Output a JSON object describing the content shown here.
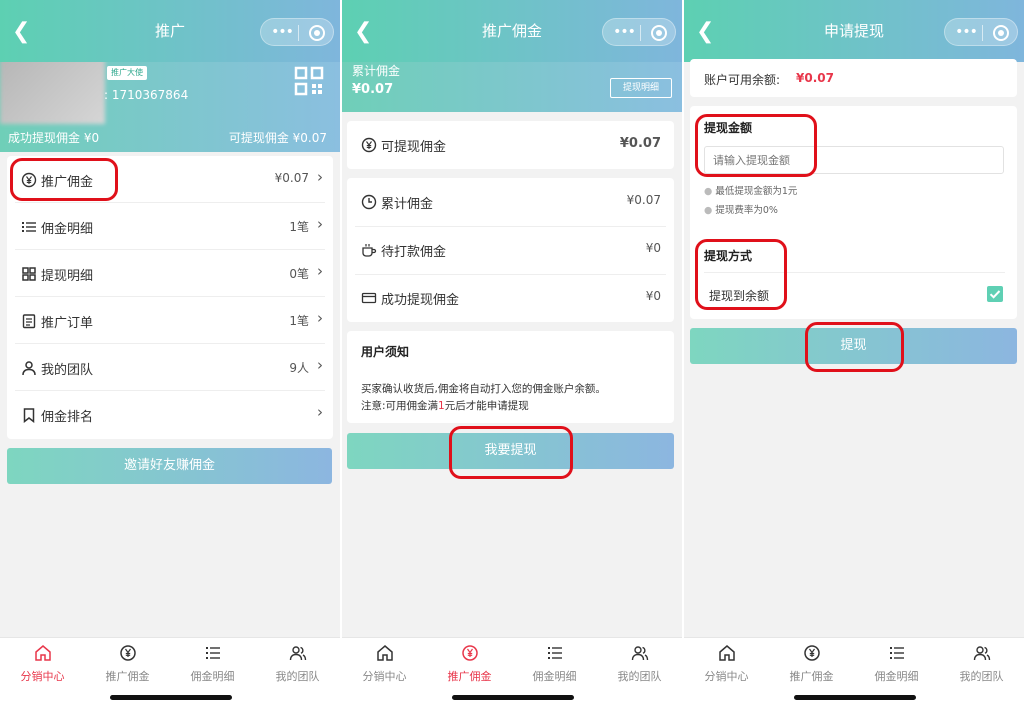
{
  "common": {
    "back_icon": "back-arrow-icon",
    "menu_dots": "•••",
    "tabs": [
      {
        "label": "分销中心",
        "icon": "home-icon"
      },
      {
        "label": "推广佣金",
        "icon": "yen-coin-icon"
      },
      {
        "label": "佣金明细",
        "icon": "list-icon"
      },
      {
        "label": "我的团队",
        "icon": "team-icon"
      }
    ],
    "accent": "#e8364a",
    "gradient_start": "#5dd0b2",
    "gradient_end": "#7fb6dc",
    "highlight_box": "#e0101a"
  },
  "screen1": {
    "title": "推广",
    "badge": "推广大使",
    "phone": ": 1710367864",
    "success_withdraw": "成功提现佣金 ¥0",
    "available_withdraw": "可提现佣金 ¥0.07",
    "items": [
      {
        "label": "推广佣金",
        "value": "¥0.07",
        "icon": "yen-circle-icon"
      },
      {
        "label": "佣金明细",
        "value": "1笔",
        "icon": "list-icon"
      },
      {
        "label": "提现明细",
        "value": "0笔",
        "icon": "grid-icon"
      },
      {
        "label": "推广订单",
        "value": "1笔",
        "icon": "clipboard-icon"
      },
      {
        "label": "我的团队",
        "value": "9人",
        "icon": "person-icon"
      },
      {
        "label": "佣金排名",
        "value": "",
        "icon": "bookmark-icon"
      }
    ],
    "invite_button": "邀请好友赚佣金"
  },
  "screen2": {
    "title": "推广佣金",
    "cumulative_label": "累计佣金",
    "cumulative_value": "¥0.07",
    "withdraw_record_button": "提现明细",
    "withdrawable_label": "可提现佣金",
    "withdrawable_value": "¥0.07",
    "stats": [
      {
        "label": "累计佣金",
        "value": "¥0.07",
        "icon": "clock-icon"
      },
      {
        "label": "待打款佣金",
        "value": "¥0",
        "icon": "cup-icon"
      },
      {
        "label": "成功提现佣金",
        "value": "¥0",
        "icon": "card-icon"
      }
    ],
    "notice_title": "用户须知",
    "notice_line1": "买家确认收货后,佣金将自动打入您的佣金账户余额。",
    "notice_line2_pre": "注意:可用佣金满",
    "notice_line2_num": "1",
    "notice_line2_post": "元后才能申请提现",
    "withdraw_button": "我要提现"
  },
  "screen3": {
    "title": "申请提现",
    "balance_label": "账户可用余额:",
    "balance_value": "¥0.07",
    "amount_label": "提现金额",
    "amount_placeholder": "请输入提现金额",
    "amount_value": "",
    "hint1": "最低提现金额为1元",
    "hint2": "提现费率为0%",
    "method_label": "提现方式",
    "method_option": "提现到余额",
    "method_checked": true,
    "submit_button": "提现"
  }
}
